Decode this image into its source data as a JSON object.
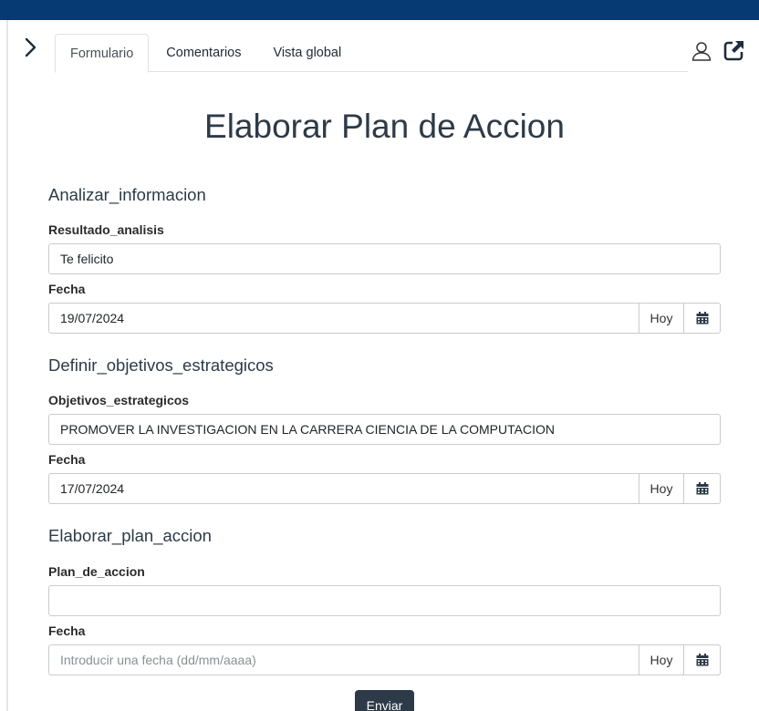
{
  "tabs": [
    {
      "label": "Formulario",
      "active": true
    },
    {
      "label": "Comentarios",
      "active": false
    },
    {
      "label": "Vista global",
      "active": false
    }
  ],
  "icons": {
    "collapse": "chevron-right-icon",
    "user": "user-icon",
    "external": "external-link-icon",
    "calendar": "calendar-icon"
  },
  "colors": {
    "topbar": "#053a72",
    "title": "#2d3a48",
    "submit": "#2d3a48"
  },
  "page_title": "Elaborar Plan de Accion",
  "sections": [
    {
      "title": "Analizar_informacion",
      "text_label": "Resultado_analisis",
      "text_value": "Te felicito",
      "date_label": "Fecha",
      "date_value": "19/07/2024",
      "today_label": "Hoy"
    },
    {
      "title": "Definir_objetivos_estrategicos",
      "text_label": "Objetivos_estrategicos",
      "text_value": "PROMOVER LA INVESTIGACION EN LA CARRERA CIENCIA DE LA COMPUTACION",
      "date_label": "Fecha",
      "date_value": "17/07/2024",
      "today_label": "Hoy"
    },
    {
      "title": "Elaborar_plan_accion",
      "text_label": "Plan_de_accion",
      "text_value": "",
      "date_label": "Fecha",
      "date_value": "",
      "date_placeholder": "Introducir una fecha (dd/mm/aaaa)",
      "today_label": "Hoy"
    }
  ],
  "submit_label": "Enviar"
}
